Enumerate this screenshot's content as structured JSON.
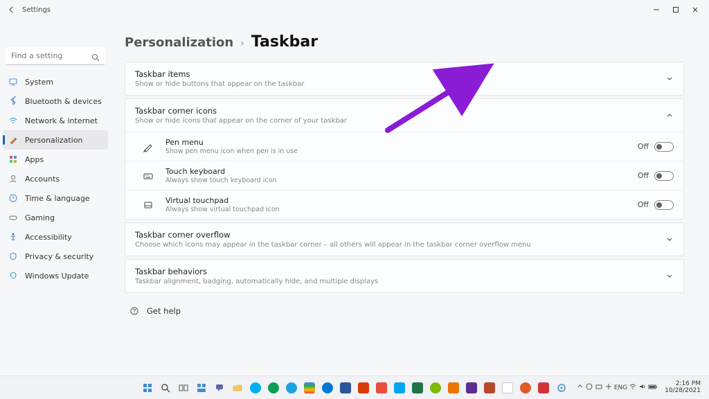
{
  "window": {
    "app_title": "Settings"
  },
  "search": {
    "placeholder": "Find a setting"
  },
  "sidebar": {
    "items": [
      {
        "label": "System"
      },
      {
        "label": "Bluetooth & devices"
      },
      {
        "label": "Network & internet"
      },
      {
        "label": "Personalization"
      },
      {
        "label": "Apps"
      },
      {
        "label": "Accounts"
      },
      {
        "label": "Time & language"
      },
      {
        "label": "Gaming"
      },
      {
        "label": "Accessibility"
      },
      {
        "label": "Privacy & security"
      },
      {
        "label": "Windows Update"
      }
    ]
  },
  "breadcrumb": {
    "parent": "Personalization",
    "sep": "›",
    "current": "Taskbar"
  },
  "sections": [
    {
      "title": "Taskbar items",
      "sub": "Show or hide buttons that appear on the taskbar"
    },
    {
      "title": "Taskbar corner icons",
      "sub": "Show or hide icons that appear on the corner of your taskbar"
    },
    {
      "title": "Taskbar corner overflow",
      "sub": "Choose which icons may appear in the taskbar corner – all others will appear in the taskbar corner overflow menu"
    },
    {
      "title": "Taskbar behaviors",
      "sub": "Taskbar alignment, badging, automatically hide, and multiple displays"
    }
  ],
  "corner_icons_rows": [
    {
      "title": "Pen menu",
      "sub": "Show pen menu icon when pen is in use",
      "state": "Off"
    },
    {
      "title": "Touch keyboard",
      "sub": "Always show touch keyboard icon",
      "state": "Off"
    },
    {
      "title": "Virtual touchpad",
      "sub": "Always show virtual touchpad icon",
      "state": "Off"
    }
  ],
  "help": {
    "label": "Get help"
  },
  "taskbar": {
    "time": "2:16 PM",
    "date": "10/28/2021"
  }
}
